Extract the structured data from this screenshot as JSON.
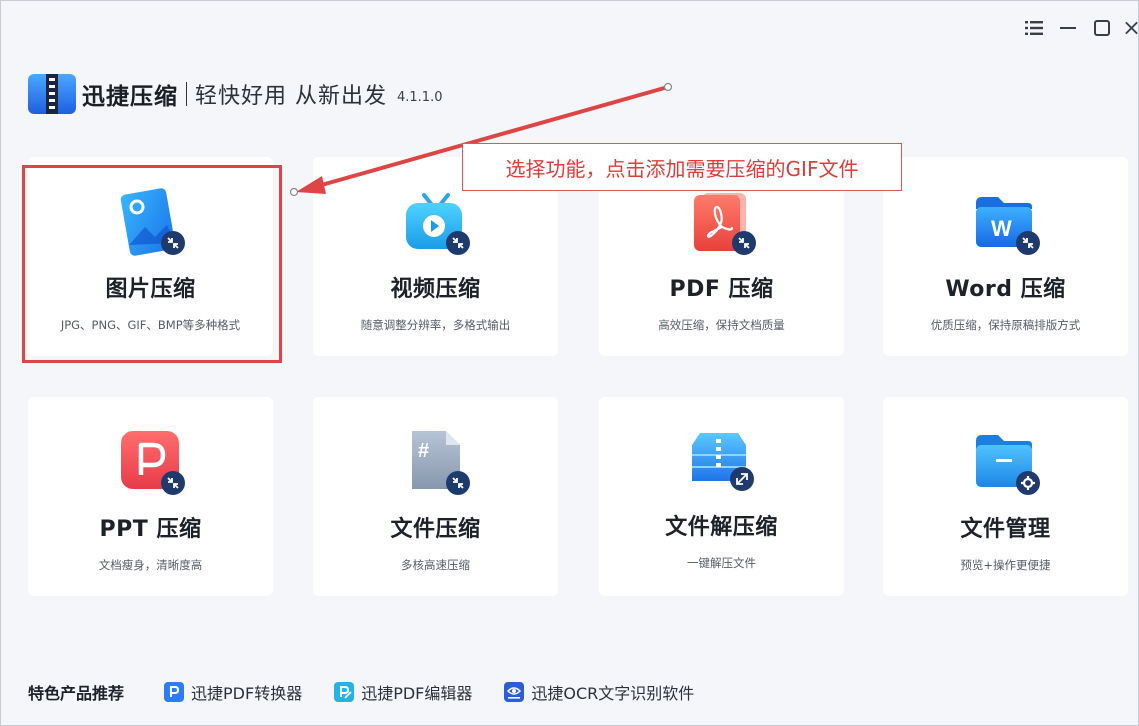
{
  "app": {
    "name": "迅捷压缩",
    "slogan": "轻快好用 从新出发",
    "version": "4.1.1.0"
  },
  "annotation": {
    "text": "选择功能，点击添加需要压缩的GIF文件"
  },
  "cards": [
    {
      "title": "图片压缩",
      "subtitle": "JPG、PNG、GIF、BMP等多种格式",
      "icon": "image-compress-icon",
      "selected": true
    },
    {
      "title": "视频压缩",
      "subtitle": "随意调整分辨率，多格式输出",
      "icon": "video-compress-icon"
    },
    {
      "title": "PDF 压缩",
      "subtitle": "高效压缩，保持文档质量",
      "icon": "pdf-compress-icon"
    },
    {
      "title": "Word 压缩",
      "subtitle": "优质压缩，保持原稿排版方式",
      "icon": "word-compress-icon"
    },
    {
      "title": "PPT 压缩",
      "subtitle": "文档瘦身，清晰度高",
      "icon": "ppt-compress-icon"
    },
    {
      "title": "文件压缩",
      "subtitle": "多核高速压缩",
      "icon": "file-compress-icon"
    },
    {
      "title": "文件解压缩",
      "subtitle": "一键解压文件",
      "icon": "file-decompress-icon"
    },
    {
      "title": "文件管理",
      "subtitle": "预览+操作更便捷",
      "icon": "file-manage-icon"
    }
  ],
  "footer": {
    "title": "特色产品推荐",
    "items": [
      {
        "label": "迅捷PDF转换器",
        "icon": "pdf-converter-icon"
      },
      {
        "label": "迅捷PDF编辑器",
        "icon": "pdf-editor-icon"
      },
      {
        "label": "迅捷OCR文字识别软件",
        "icon": "ocr-icon"
      }
    ]
  },
  "colors": {
    "accent": "#2f6bff",
    "annotation_red": "#e04545",
    "card_bg": "#ffffff",
    "page_bg": "#f4f6fa"
  }
}
